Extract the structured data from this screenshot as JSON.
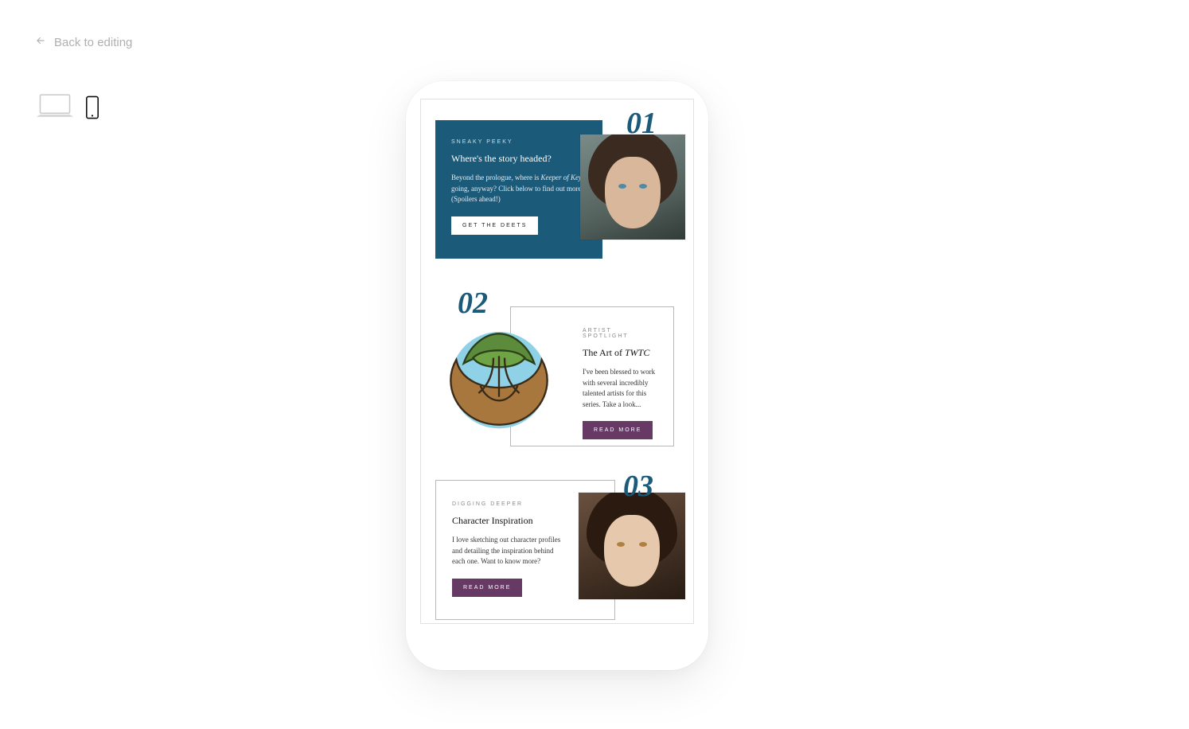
{
  "nav": {
    "back_label": "Back to editing"
  },
  "devices": {
    "desktop": "desktop-preview",
    "mobile": "mobile-preview",
    "active": "mobile-preview"
  },
  "cards": [
    {
      "number": "01",
      "eyebrow": "SNEAKY PEEKY",
      "title": "Where's the story headed?",
      "body_pre": "Beyond the prologue, where is ",
      "body_em": "Keeper of Keys",
      "body_post": " going, anyway? Click below to find out more. (Spoilers ahead!)",
      "button": "GET THE DEETS",
      "image_alt": "portrait-male-character"
    },
    {
      "number": "02",
      "eyebrow": "ARTIST SPOTLIGHT",
      "title_pre": "The Art of ",
      "title_em": "TWTC",
      "body": "I've been blessed to work with several incredibly talented artists for this series. Take a look...",
      "button": "READ MORE",
      "image_alt": "celtic-tree-emblem"
    },
    {
      "number": "03",
      "eyebrow": "DIGGING DEEPER",
      "title": "Character Inspiration",
      "body": "I love sketching out character profiles and detailing the inspiration behind each one. Want to know more?",
      "button": "READ MORE",
      "image_alt": "portrait-female-character"
    }
  ]
}
